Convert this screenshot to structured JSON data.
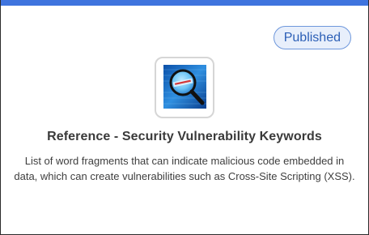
{
  "card": {
    "accent_color": "#3f74de",
    "status_badge": "Published",
    "thumbnail_icon": "magnifier-vulnerability-icon",
    "title": "Reference - Security Vulnerability Keywords",
    "description": "List of word fragments that can indicate malicious code embedded in data, which can create vulnerabilities such as Cross-Site Scripting (XSS)."
  }
}
